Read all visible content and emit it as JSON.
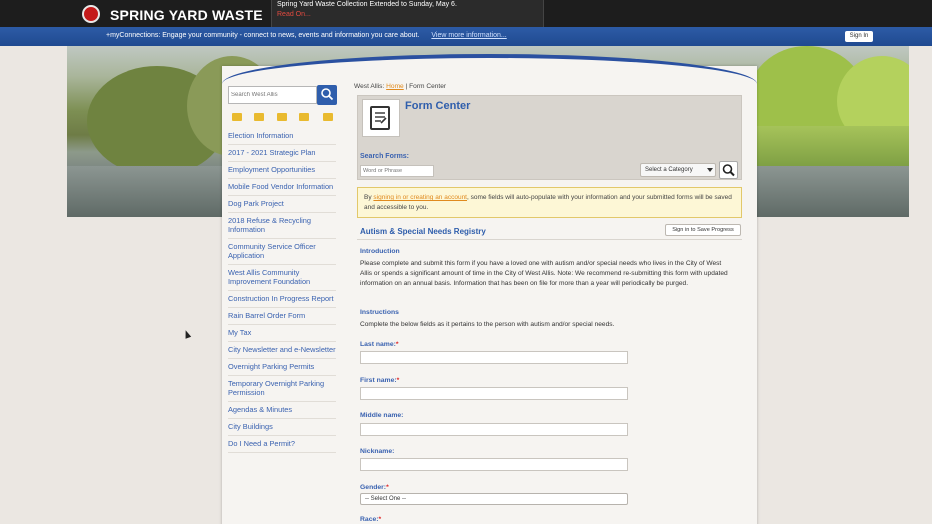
{
  "header": {
    "logo_text": "SPRING YARD WASTE",
    "alert_text": "Spring Yard Waste Collection Extended to Sunday, May 6.",
    "alert_link": "Read On..."
  },
  "connections": {
    "text": "+myConnections: Engage your community - connect to news, events and information you care about.",
    "link": "View more information...",
    "signin": "Sign In"
  },
  "sidebar": {
    "search_placeholder": "Search West Allis",
    "items": [
      {
        "label": "Election Information"
      },
      {
        "label": "2017 - 2021 Strategic Plan"
      },
      {
        "label": "Employment Opportunities"
      },
      {
        "label": "Mobile Food Vendor Information"
      },
      {
        "label": "Dog Park Project"
      },
      {
        "label": "2018 Refuse & Recycling Information"
      },
      {
        "label": "Community Service Officer Application"
      },
      {
        "label": "West Allis Community Improvement Foundation"
      },
      {
        "label": "Construction In Progress Report"
      },
      {
        "label": "Rain Barrel Order Form"
      },
      {
        "label": "My Tax"
      },
      {
        "label": "City Newsletter and e-Newsletter"
      },
      {
        "label": "Overnight Parking Permits"
      },
      {
        "label": "Temporary Overnight Parking Permission"
      },
      {
        "label": "Agendas & Minutes"
      },
      {
        "label": "City Buildings"
      },
      {
        "label": "Do I Need a Permit?"
      }
    ]
  },
  "breadcrumb": {
    "prefix": "West Allis:",
    "home": "Home",
    "current": "| Form Center"
  },
  "form_center": {
    "title": "Form Center",
    "search_label": "Search Forms:",
    "word_placeholder": "Word or Phrase",
    "category": "Select a Category"
  },
  "notice": {
    "by": "By ",
    "link": "signing in or creating an account",
    "rest": ", some fields will auto-populate with your information and your submitted forms will be saved and accessible to you."
  },
  "form": {
    "title": "Autism & Special Needs Registry",
    "save_button": "Sign in to Save Progress",
    "intro_head": "Introduction",
    "intro_text": "Please complete and submit this form if you have a loved one with autism and/or special needs who lives in the City of West Allis or spends a significant amount of time in the City of West Allis. Note: We recommend re-submitting this form with updated information on an annual basis. Information that has been on file for more than a year will periodically be purged.",
    "instr_head": "Instructions",
    "instr_text": "Complete the below fields as it pertains to the person with autism and/or special needs.",
    "fields": {
      "last_name": "Last name:",
      "first_name": "First name:",
      "middle_name": "Middle name:",
      "nickname": "Nickname:",
      "gender": "Gender:",
      "race": "Race:"
    },
    "required_mark": "*",
    "gender_value": "-- Select One --"
  }
}
